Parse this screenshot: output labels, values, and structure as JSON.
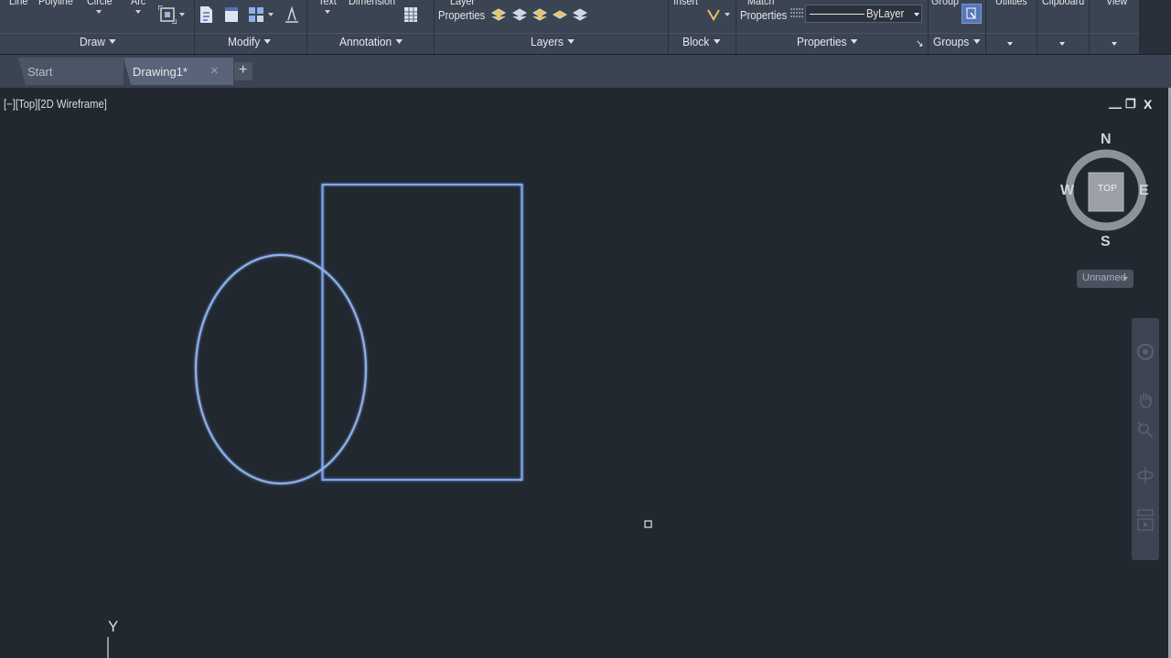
{
  "ribbon": {
    "cut_labels": {
      "line": "Line",
      "polyline": "Polyline",
      "circle": "Circle",
      "arc": "Arc",
      "text": "Text",
      "dimension": "Dimension",
      "layer": "Layer",
      "insert": "Insert",
      "match": "Match",
      "group": "Group",
      "utilities": "Utilities",
      "clipboard": "Clipboard",
      "view": "View"
    },
    "layer_properties_label": "Properties",
    "match_properties_label": "Properties",
    "linetype_value": "ByLayer",
    "panels": {
      "draw": "Draw",
      "modify": "Modify",
      "annotation": "Annotation",
      "layers": "Layers",
      "block": "Block",
      "properties": "Properties",
      "groups": "Groups"
    },
    "properties_launcher": "↘"
  },
  "tabs": {
    "start": "Start",
    "drawing": "Drawing1*",
    "close_glyph": "×",
    "new_tab_glyph": "+"
  },
  "viewport": {
    "label": "[−][Top][2D Wireframe]",
    "minimize": "—",
    "restore": "❐",
    "close": "X"
  },
  "viewcube": {
    "north": "N",
    "south": "S",
    "east": "E",
    "west": "W",
    "face": "TOP"
  },
  "wcs_menu": "Unnamed",
  "ucs_y_label": "Y",
  "colors": {
    "background": "#212830",
    "ribbon": "#3b4453",
    "geometry": "#7fa6f0",
    "viewcube_ring": "#8d939b"
  },
  "icons": [
    "zoom-window-icon",
    "block-insert-icon",
    "table-icon",
    "layer-state-icon",
    "edit-attribute-icon",
    "pickadd-icon",
    "navigation-wheel-icon",
    "pan-hand-icon",
    "zoom-extents-icon",
    "orbit-icon",
    "showmotion-icon"
  ]
}
